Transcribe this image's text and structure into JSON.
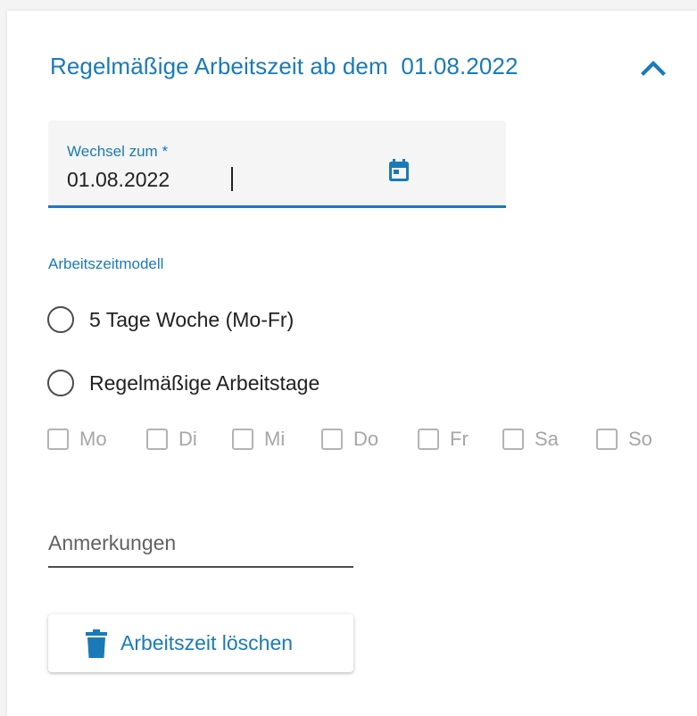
{
  "panel": {
    "title": "Regelmäßige Arbeitszeit ab dem  01.08.2022",
    "collapse_icon": "chevron-up-icon"
  },
  "date_field": {
    "label": "Wechsel zum *",
    "value": "01.08.2022",
    "icon": "calendar-icon"
  },
  "work_model": {
    "label": "Arbeitszeitmodell",
    "options": [
      {
        "label": "5 Tage Woche (Mo-Fr)",
        "selected": false
      },
      {
        "label": "Regelmäßige Arbeitstage",
        "selected": false
      }
    ],
    "days": [
      {
        "label": "Mo",
        "checked": false,
        "disabled": true
      },
      {
        "label": "Di",
        "checked": false,
        "disabled": true
      },
      {
        "label": "Mi",
        "checked": false,
        "disabled": true
      },
      {
        "label": "Do",
        "checked": false,
        "disabled": true
      },
      {
        "label": "Fr",
        "checked": false,
        "disabled": true
      },
      {
        "label": "Sa",
        "checked": false,
        "disabled": true
      },
      {
        "label": "So",
        "checked": false,
        "disabled": true
      }
    ]
  },
  "notes": {
    "placeholder": "Anmerkungen",
    "value": ""
  },
  "delete_button": {
    "label": "Arbeitszeit löschen",
    "icon": "trash-icon"
  },
  "colors": {
    "accent": "#1a7ab8",
    "disabled": "#a6a6a6",
    "text": "#212121"
  }
}
